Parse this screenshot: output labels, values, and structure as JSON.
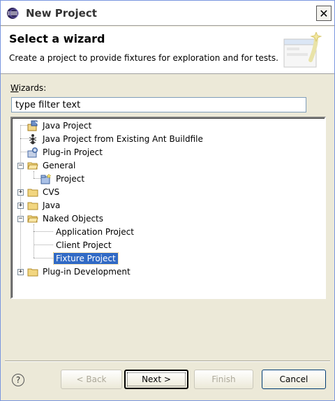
{
  "window": {
    "title": "New Project",
    "close_label": "✕"
  },
  "banner": {
    "title": "Select a wizard",
    "description": "Create a project to provide fixtures for exploration and for tests."
  },
  "wizards": {
    "label_underlined": "W",
    "label_rest": "izards:",
    "filter_value": "type filter text"
  },
  "tree": {
    "items": [
      {
        "label": "Java Project",
        "icon": "java-project-icon",
        "depth": 1
      },
      {
        "label": "Java Project from Existing Ant Buildfile",
        "icon": "ant-icon",
        "depth": 1
      },
      {
        "label": "Plug-in Project",
        "icon": "plugin-project-icon",
        "depth": 1
      },
      {
        "label": "General",
        "icon": "folder-open-icon",
        "depth": 1,
        "expander": "−"
      },
      {
        "label": "Project",
        "icon": "project-icon",
        "depth": 2
      },
      {
        "label": "CVS",
        "icon": "folder-icon",
        "depth": 1,
        "expander": "+"
      },
      {
        "label": "Java",
        "icon": "folder-icon",
        "depth": 1,
        "expander": "+"
      },
      {
        "label": "Naked Objects",
        "icon": "folder-open-icon",
        "depth": 1,
        "expander": "−"
      },
      {
        "label": "Application Project",
        "icon": "none",
        "depth": 2
      },
      {
        "label": "Client Project",
        "icon": "none",
        "depth": 2
      },
      {
        "label": "Fixture Project",
        "icon": "none",
        "depth": 2,
        "selected": true
      },
      {
        "label": "Plug-in Development",
        "icon": "folder-icon",
        "depth": 1,
        "expander": "+"
      }
    ]
  },
  "buttons": {
    "help": "?",
    "back_label": "< Back",
    "next_label": "Next >",
    "finish_label": "Finish",
    "cancel_label": "Cancel"
  },
  "colors": {
    "selection": "#316ac5",
    "dialog_bg": "#ece9d8"
  }
}
